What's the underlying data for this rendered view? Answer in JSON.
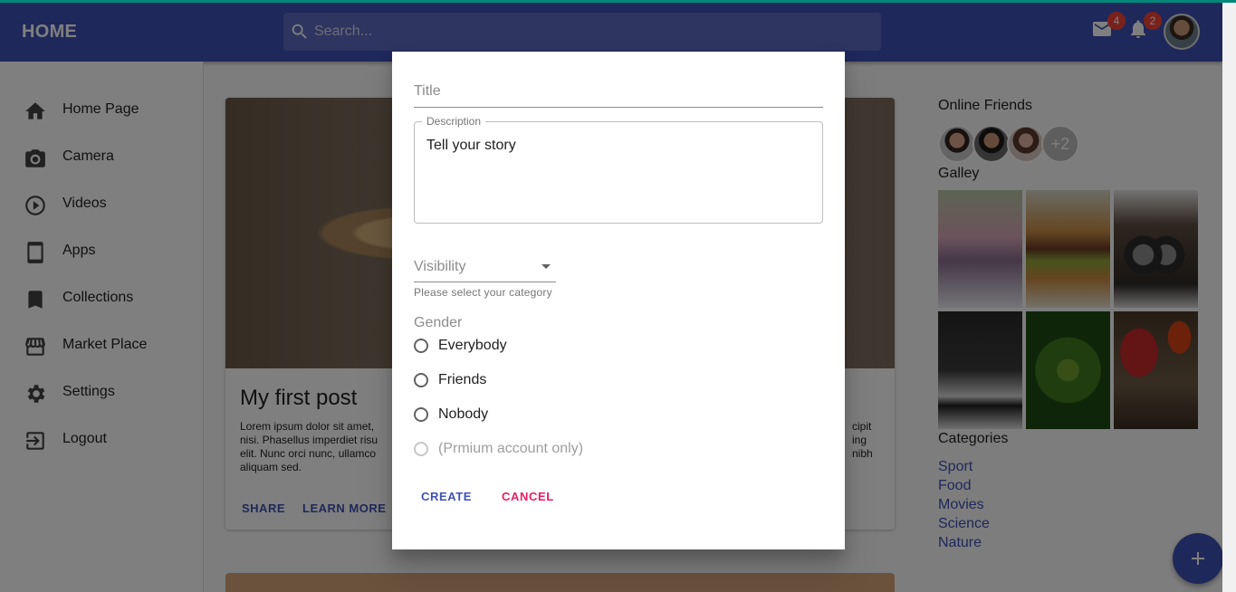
{
  "appbar": {
    "brand": "HOME",
    "search_placeholder": "Search...",
    "mail_badge": "4",
    "notifications_badge": "2"
  },
  "sidebar": {
    "items": [
      {
        "label": "Home Page",
        "icon": "home-icon"
      },
      {
        "label": "Camera",
        "icon": "camera-icon"
      },
      {
        "label": "Videos",
        "icon": "play-circle-icon"
      },
      {
        "label": "Apps",
        "icon": "tablet-icon"
      },
      {
        "label": "Collections",
        "icon": "bookmark-icon"
      },
      {
        "label": "Market Place",
        "icon": "storefront-icon"
      },
      {
        "label": "Settings",
        "icon": "gear-icon"
      },
      {
        "label": "Logout",
        "icon": "logout-icon"
      }
    ]
  },
  "card": {
    "title": "My first post",
    "body_visible_left": "Lorem ipsum dolor sit amet, nisi. Phasellus imperdiet risu elit. Nunc orci nunc, ullamco aliquam sed.",
    "body_visible_right": "cipit ing nibh",
    "actions": [
      "SHARE",
      "LEARN MORE"
    ]
  },
  "right": {
    "online_friends_title": "Online Friends",
    "friends_more": "+2",
    "gallery_title": "Galley",
    "categories_title": "Categories",
    "categories": [
      "Sport",
      "Food",
      "Movies",
      "Science",
      "Nature"
    ]
  },
  "dialog": {
    "title_placeholder": "Title",
    "description_label": "Description",
    "description_value": "Tell your story",
    "visibility_value": "Visibility",
    "visibility_helper": "Please select your category",
    "gender_label": "Gender",
    "options": [
      "Everybody",
      "Friends",
      "Nobody",
      "(Prmium account only)"
    ],
    "create_label": "CREATE",
    "cancel_label": "CANCEL"
  },
  "colors": {
    "primary": "#3f51b5",
    "secondary": "#e91e63",
    "badge": "#f44336"
  }
}
